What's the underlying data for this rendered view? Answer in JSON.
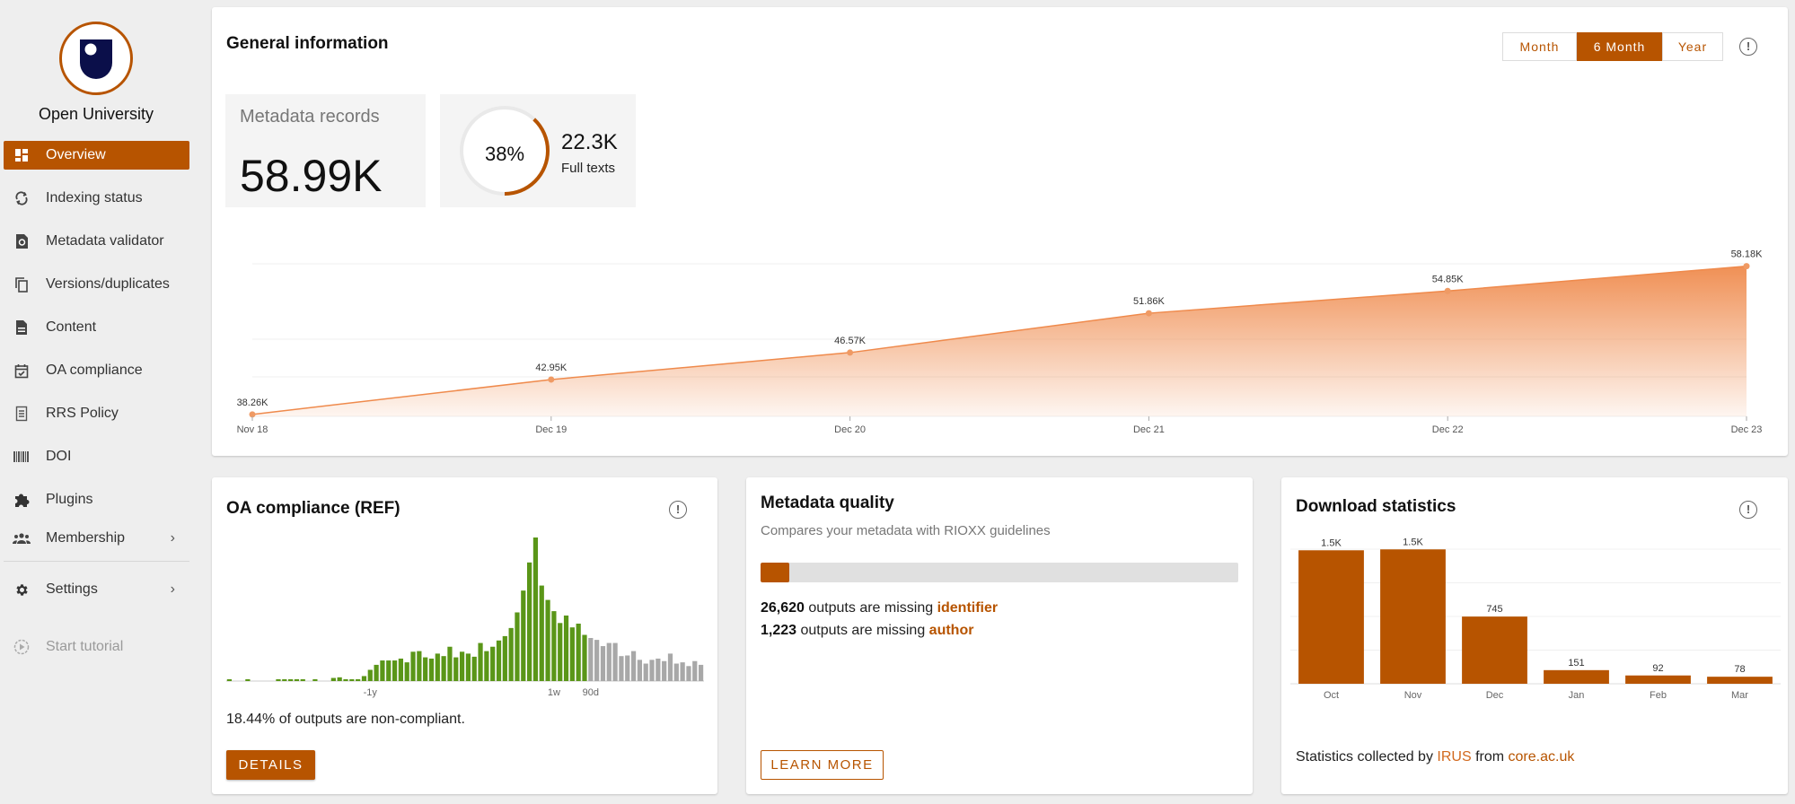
{
  "sidebar": {
    "org_name": "Open University",
    "items": [
      {
        "label": "Overview",
        "icon": "dashboard-icon",
        "active": true
      },
      {
        "label": "Indexing status",
        "icon": "sync-icon"
      },
      {
        "label": "Metadata validator",
        "icon": "file-restore-icon"
      },
      {
        "label": "Versions/duplicates",
        "icon": "copy-icon"
      },
      {
        "label": "Content",
        "icon": "document-icon"
      },
      {
        "label": "OA compliance",
        "icon": "calendar-check-icon"
      },
      {
        "label": "RRS Policy",
        "icon": "policy-doc-icon"
      },
      {
        "label": "DOI",
        "icon": "barcode-icon"
      },
      {
        "label": "Plugins",
        "icon": "puzzle-icon"
      },
      {
        "label": "Membership",
        "icon": "group-icon",
        "has_submenu": true
      },
      {
        "label": "Settings",
        "icon": "gear-icon",
        "has_submenu": true
      }
    ],
    "tutorial_label": "Start tutorial"
  },
  "general": {
    "title": "General information",
    "periods": [
      "Month",
      "6 Month",
      "Year"
    ],
    "selected_period": "6 Month",
    "metadata_label": "Metadata records",
    "metadata_value": "58.99K",
    "fulltext_percent": 38,
    "fulltext_percent_label": "38%",
    "fulltext_value": "22.3K",
    "fulltext_label": "Full texts"
  },
  "oa": {
    "title": "OA compliance (REF)",
    "summary": "18.44% of outputs are non-compliant.",
    "details_label": "DETAILS"
  },
  "metadata_quality": {
    "title": "Metadata quality",
    "subtitle": "Compares your metadata with RIOXX guidelines",
    "progress_percent": 6,
    "missing": [
      {
        "count": "26,620",
        "text": " outputs are missing ",
        "field": "identifier"
      },
      {
        "count": "1,223",
        "text": " outputs are missing ",
        "field": "author"
      }
    ],
    "learn_more_label": "LEARN MORE"
  },
  "downloads": {
    "title": "Download statistics",
    "footer_prefix": "Statistics collected by ",
    "footer_link1": "IRUS",
    "footer_mid": " from ",
    "footer_link2": "core.ac.uk"
  },
  "colors": {
    "accent": "#b75400",
    "area": "#ef8a4c",
    "compliant": "#5a9618",
    "noncompliant": "#a8a8a8"
  },
  "chart_data": [
    {
      "type": "area",
      "title": "Metadata records over time",
      "x": [
        "Nov 18",
        "Dec 19",
        "Dec 20",
        "Dec 21",
        "Dec 22",
        "Dec 23"
      ],
      "values": [
        38260,
        42950,
        46570,
        51860,
        54850,
        58180
      ],
      "labels": [
        "38.26K",
        "42.95K",
        "46.57K",
        "51.86K",
        "54.85K",
        "58.18K"
      ],
      "ylim": [
        38000,
        58500
      ],
      "gridlines": [
        40000,
        50000,
        58500
      ],
      "grid": true
    },
    {
      "type": "bar",
      "title": "OA compliance (REF) histogram",
      "tick_labels": [
        {
          "label": "-1y",
          "index": 23
        },
        {
          "label": "1w",
          "index": 53
        },
        {
          "label": "90d",
          "index": 59
        }
      ],
      "compliant_values": [
        0.3,
        0,
        0,
        0.3,
        0,
        0,
        0,
        0,
        0.3,
        0.3,
        0.3,
        0.3,
        0.3,
        0,
        0.3,
        0,
        0,
        0.5,
        0.6,
        0.3,
        0.3,
        0.3,
        0.8,
        1.8,
        2.6,
        3.3,
        3.3,
        3.3,
        3.6,
        3.0,
        4.7,
        4.8,
        3.8,
        3.6,
        4.4,
        4.0,
        5.5,
        3.8,
        4.7,
        4.4,
        3.9,
        6.1,
        4.8,
        5.5,
        6.5,
        7.2,
        8.5,
        11,
        14.5,
        19,
        23,
        15.3,
        13,
        11.2,
        9.3,
        10.5,
        8.6,
        9.2,
        7.4
      ],
      "noncompliant_values": [
        6.9,
        6.6,
        5.6,
        6.1,
        6.1,
        4.0,
        4.1,
        4.8,
        3.4,
        2.8,
        3.4,
        3.6,
        3.2,
        4.4,
        2.8,
        3.0,
        2.4,
        3.2,
        2.6
      ],
      "ylim": [
        0,
        23
      ]
    },
    {
      "type": "bar",
      "title": "Download statistics",
      "categories": [
        "Oct",
        "Nov",
        "Dec",
        "Jan",
        "Feb",
        "Mar"
      ],
      "values": [
        1480,
        1490,
        745,
        151,
        92,
        78
      ],
      "labels": [
        "1.5K",
        "1.5K",
        "745",
        "151",
        "92",
        "78"
      ],
      "ylim": [
        0,
        2000
      ],
      "grid": true
    }
  ]
}
